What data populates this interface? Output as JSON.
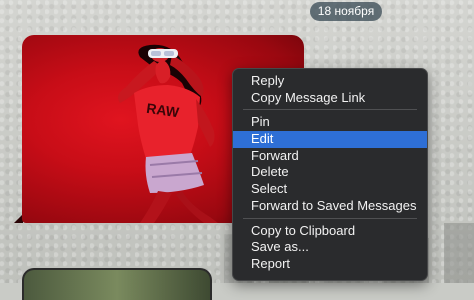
{
  "chat": {
    "date_badge": "18 ноября"
  },
  "photo": {
    "shirt_text": "RAW"
  },
  "context_menu": {
    "groups": [
      [
        {
          "label": "Reply",
          "selected": false
        },
        {
          "label": "Copy Message Link",
          "selected": false
        }
      ],
      [
        {
          "label": "Pin",
          "selected": false
        },
        {
          "label": "Edit",
          "selected": true
        },
        {
          "label": "Forward",
          "selected": false
        },
        {
          "label": "Delete",
          "selected": false
        },
        {
          "label": "Select",
          "selected": false
        },
        {
          "label": "Forward to Saved Messages",
          "selected": false
        }
      ],
      [
        {
          "label": "Copy to Clipboard",
          "selected": false
        },
        {
          "label": "Save as...",
          "selected": false
        },
        {
          "label": "Report",
          "selected": false
        }
      ]
    ],
    "highlight_color": "#2e6fd6",
    "background_color": "#2a2b2d"
  }
}
